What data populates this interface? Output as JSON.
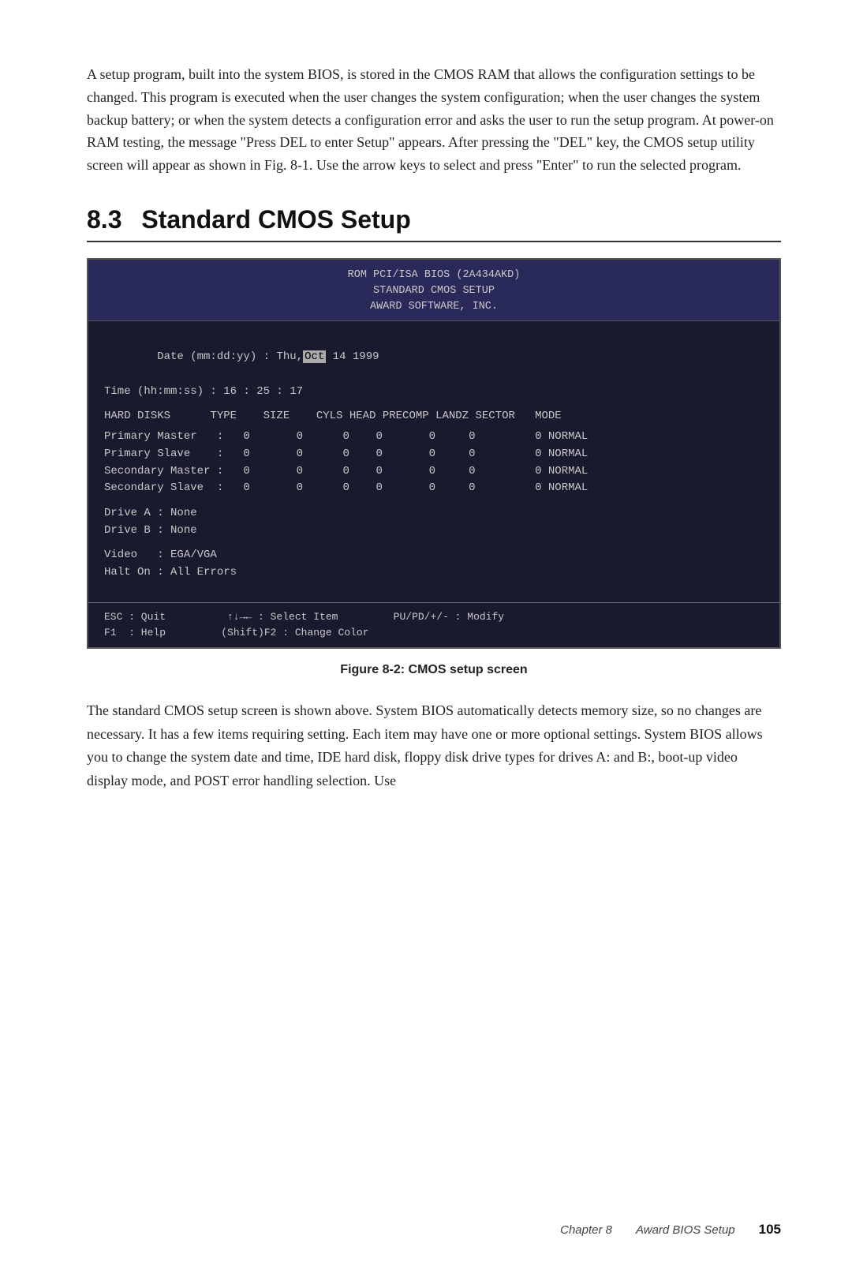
{
  "intro": {
    "paragraph": "A setup program, built into the system BIOS, is stored in the CMOS RAM that allows the configuration settings to be changed. This program is executed when the user changes the system configuration; when the user changes the system backup battery; or when the system detects a configuration error and asks the user to run the setup program. At power-on RAM testing, the message \"Press DEL to enter Setup\" appears. After pressing the \"DEL\" key, the CMOS setup utility screen will appear as shown in Fig. 8-1. Use the arrow keys to select and press \"Enter\" to run the selected program."
  },
  "section": {
    "number": "8.3",
    "title": "Standard CMOS Setup"
  },
  "cmos": {
    "header_line1": "ROM PCI/ISA BIOS (2A434AKD)",
    "header_line2": "STANDARD CMOS SETUP",
    "header_line3": "AWARD SOFTWARE, INC.",
    "date_label": "Date (mm:dd:yy) : Thu,",
    "date_highlight": "Oct",
    "date_rest": " 14 1999",
    "time_label": "Time (hh:mm:ss) : 16 : 25 : 17",
    "table_header": "HARD DISKS      TYPE    SIZE    CYLS HEAD PRECOMP LANDZ SECTOR   MODE",
    "rows": [
      "Primary Master   :   0       0      0    0       0     0         0 NORMAL",
      "Primary Slave    :   0       0      0    0       0     0         0 NORMAL",
      "Secondary Master :   0       0      0    0       0     0         0 NORMAL",
      "Secondary Slave  :   0       0      0    0       0     0         0 NORMAL"
    ],
    "drive_a": "Drive A : None",
    "drive_b": "Drive B : None",
    "video": "Video   : EGA/VGA",
    "halt": "Halt On : All Errors",
    "footer_line1": "ESC : Quit          ↑↓→← : Select Item         PU/PD/+/- : Modify",
    "footer_line2": "F1  : Help         (Shift)F2 : Change Color"
  },
  "figure_caption": "Figure 8-2: CMOS setup screen",
  "body_text": "The standard CMOS setup screen is shown above. System BIOS automatically detects memory size, so no changes are necessary. It has a few items requiring setting. Each item may have one or more optional settings. System BIOS allows you to change the system date and time, IDE hard disk, floppy disk drive types for drives A: and B:, boot-up video display mode, and POST error handling selection. Use",
  "footer": {
    "chapter": "Chapter 8",
    "section": "Award BIOS Setup",
    "page": "105"
  }
}
